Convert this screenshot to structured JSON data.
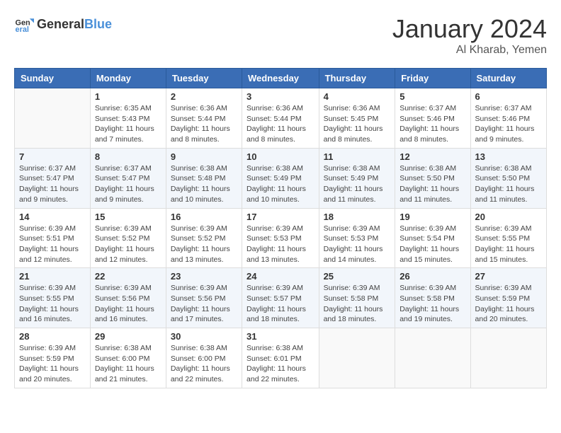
{
  "header": {
    "logo_general": "General",
    "logo_blue": "Blue",
    "month_year": "January 2024",
    "location": "Al Kharab, Yemen"
  },
  "calendar": {
    "days_of_week": [
      "Sunday",
      "Monday",
      "Tuesday",
      "Wednesday",
      "Thursday",
      "Friday",
      "Saturday"
    ],
    "weeks": [
      [
        {
          "day": "",
          "info": ""
        },
        {
          "day": "1",
          "info": "Sunrise: 6:35 AM\nSunset: 5:43 PM\nDaylight: 11 hours\nand 7 minutes."
        },
        {
          "day": "2",
          "info": "Sunrise: 6:36 AM\nSunset: 5:44 PM\nDaylight: 11 hours\nand 8 minutes."
        },
        {
          "day": "3",
          "info": "Sunrise: 6:36 AM\nSunset: 5:44 PM\nDaylight: 11 hours\nand 8 minutes."
        },
        {
          "day": "4",
          "info": "Sunrise: 6:36 AM\nSunset: 5:45 PM\nDaylight: 11 hours\nand 8 minutes."
        },
        {
          "day": "5",
          "info": "Sunrise: 6:37 AM\nSunset: 5:46 PM\nDaylight: 11 hours\nand 8 minutes."
        },
        {
          "day": "6",
          "info": "Sunrise: 6:37 AM\nSunset: 5:46 PM\nDaylight: 11 hours\nand 9 minutes."
        }
      ],
      [
        {
          "day": "7",
          "info": "Sunrise: 6:37 AM\nSunset: 5:47 PM\nDaylight: 11 hours\nand 9 minutes."
        },
        {
          "day": "8",
          "info": "Sunrise: 6:37 AM\nSunset: 5:47 PM\nDaylight: 11 hours\nand 9 minutes."
        },
        {
          "day": "9",
          "info": "Sunrise: 6:38 AM\nSunset: 5:48 PM\nDaylight: 11 hours\nand 10 minutes."
        },
        {
          "day": "10",
          "info": "Sunrise: 6:38 AM\nSunset: 5:49 PM\nDaylight: 11 hours\nand 10 minutes."
        },
        {
          "day": "11",
          "info": "Sunrise: 6:38 AM\nSunset: 5:49 PM\nDaylight: 11 hours\nand 11 minutes."
        },
        {
          "day": "12",
          "info": "Sunrise: 6:38 AM\nSunset: 5:50 PM\nDaylight: 11 hours\nand 11 minutes."
        },
        {
          "day": "13",
          "info": "Sunrise: 6:38 AM\nSunset: 5:50 PM\nDaylight: 11 hours\nand 11 minutes."
        }
      ],
      [
        {
          "day": "14",
          "info": "Sunrise: 6:39 AM\nSunset: 5:51 PM\nDaylight: 11 hours\nand 12 minutes."
        },
        {
          "day": "15",
          "info": "Sunrise: 6:39 AM\nSunset: 5:52 PM\nDaylight: 11 hours\nand 12 minutes."
        },
        {
          "day": "16",
          "info": "Sunrise: 6:39 AM\nSunset: 5:52 PM\nDaylight: 11 hours\nand 13 minutes."
        },
        {
          "day": "17",
          "info": "Sunrise: 6:39 AM\nSunset: 5:53 PM\nDaylight: 11 hours\nand 13 minutes."
        },
        {
          "day": "18",
          "info": "Sunrise: 6:39 AM\nSunset: 5:53 PM\nDaylight: 11 hours\nand 14 minutes."
        },
        {
          "day": "19",
          "info": "Sunrise: 6:39 AM\nSunset: 5:54 PM\nDaylight: 11 hours\nand 15 minutes."
        },
        {
          "day": "20",
          "info": "Sunrise: 6:39 AM\nSunset: 5:55 PM\nDaylight: 11 hours\nand 15 minutes."
        }
      ],
      [
        {
          "day": "21",
          "info": "Sunrise: 6:39 AM\nSunset: 5:55 PM\nDaylight: 11 hours\nand 16 minutes."
        },
        {
          "day": "22",
          "info": "Sunrise: 6:39 AM\nSunset: 5:56 PM\nDaylight: 11 hours\nand 16 minutes."
        },
        {
          "day": "23",
          "info": "Sunrise: 6:39 AM\nSunset: 5:56 PM\nDaylight: 11 hours\nand 17 minutes."
        },
        {
          "day": "24",
          "info": "Sunrise: 6:39 AM\nSunset: 5:57 PM\nDaylight: 11 hours\nand 18 minutes."
        },
        {
          "day": "25",
          "info": "Sunrise: 6:39 AM\nSunset: 5:58 PM\nDaylight: 11 hours\nand 18 minutes."
        },
        {
          "day": "26",
          "info": "Sunrise: 6:39 AM\nSunset: 5:58 PM\nDaylight: 11 hours\nand 19 minutes."
        },
        {
          "day": "27",
          "info": "Sunrise: 6:39 AM\nSunset: 5:59 PM\nDaylight: 11 hours\nand 20 minutes."
        }
      ],
      [
        {
          "day": "28",
          "info": "Sunrise: 6:39 AM\nSunset: 5:59 PM\nDaylight: 11 hours\nand 20 minutes."
        },
        {
          "day": "29",
          "info": "Sunrise: 6:38 AM\nSunset: 6:00 PM\nDaylight: 11 hours\nand 21 minutes."
        },
        {
          "day": "30",
          "info": "Sunrise: 6:38 AM\nSunset: 6:00 PM\nDaylight: 11 hours\nand 22 minutes."
        },
        {
          "day": "31",
          "info": "Sunrise: 6:38 AM\nSunset: 6:01 PM\nDaylight: 11 hours\nand 22 minutes."
        },
        {
          "day": "",
          "info": ""
        },
        {
          "day": "",
          "info": ""
        },
        {
          "day": "",
          "info": ""
        }
      ]
    ]
  }
}
